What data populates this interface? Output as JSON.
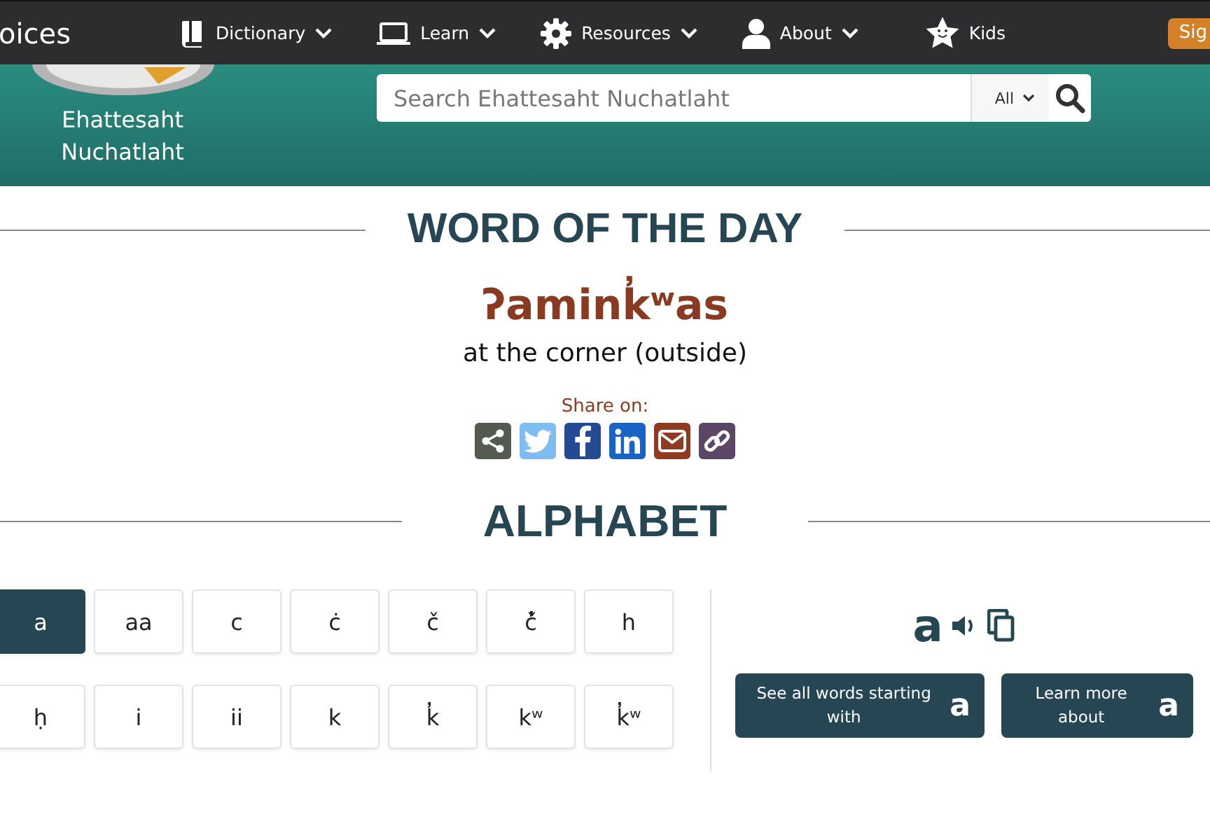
{
  "nav": {
    "brand": "oices",
    "items": [
      {
        "label": "Dictionary",
        "caret": true
      },
      {
        "label": "Learn",
        "caret": true
      },
      {
        "label": "Resources",
        "caret": true
      },
      {
        "label": "About",
        "caret": true
      },
      {
        "label": "Kids",
        "caret": false
      }
    ],
    "sign_button": "Sig"
  },
  "header": {
    "community": "Ehattesaht Nuchatlaht",
    "search": {
      "placeholder": "Search Ehattesaht Nuchatlaht",
      "scope": "All"
    }
  },
  "word_of_the_day": {
    "heading": "WORD OF THE DAY",
    "word": "ʔamink̓ʷas",
    "translation": "at the corner (outside)",
    "share_label": "Share on:",
    "share": [
      {
        "kind": "share",
        "color": "#535a4f"
      },
      {
        "kind": "twitter",
        "color": "#7fbdf0"
      },
      {
        "kind": "facebook",
        "color": "#234a92"
      },
      {
        "kind": "linkedin",
        "color": "#1a63c4"
      },
      {
        "kind": "email",
        "color": "#8f3a21"
      },
      {
        "kind": "link",
        "color": "#5b4668"
      }
    ]
  },
  "alphabet": {
    "heading": "ALPHABET",
    "letters": [
      {
        "char": "a",
        "selected": true
      },
      {
        "char": "aa",
        "selected": false
      },
      {
        "char": "c",
        "selected": false
      },
      {
        "char": "ċ",
        "selected": false
      },
      {
        "char": "č",
        "selected": false
      },
      {
        "char": "č̓",
        "selected": false
      },
      {
        "char": "h",
        "selected": false
      },
      {
        "char": "ḥ",
        "selected": false
      },
      {
        "char": "i",
        "selected": false
      },
      {
        "char": "ii",
        "selected": false
      },
      {
        "char": "k",
        "selected": false
      },
      {
        "char": "k̓",
        "selected": false
      },
      {
        "char": "kʷ",
        "selected": false
      },
      {
        "char": "k̓ʷ",
        "selected": false
      }
    ],
    "current": "a",
    "see_all": {
      "label": "See all words starting with",
      "letter": "a"
    },
    "learn_more": {
      "label": "Learn more about",
      "letter": "a"
    }
  }
}
